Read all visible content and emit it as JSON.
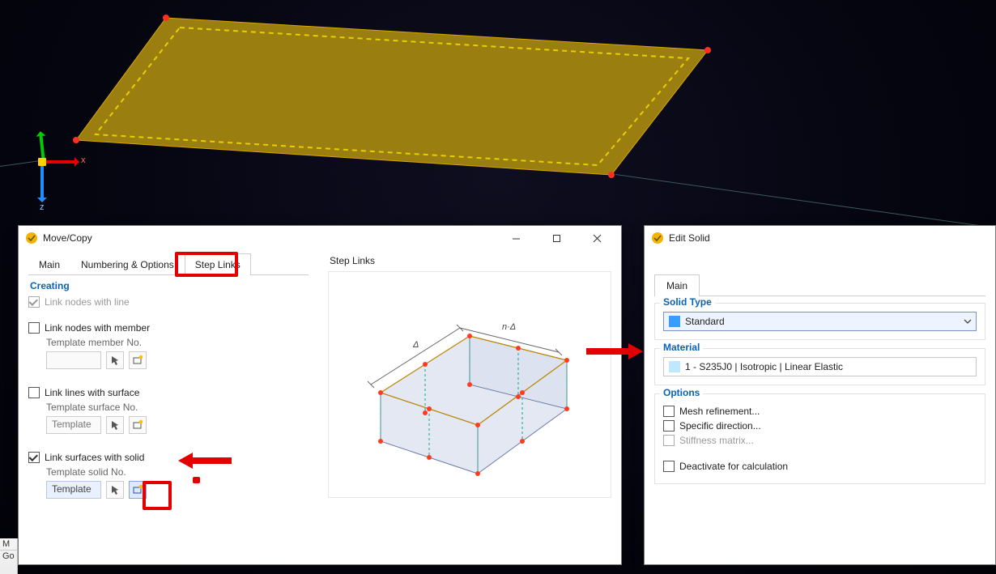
{
  "movecopy": {
    "title": "Move/Copy",
    "tabs": {
      "main": "Main",
      "numbering": "Numbering & Options",
      "steplinks": "Step Links"
    },
    "section_creating": "Creating",
    "link_nodes_line": "Link nodes with line",
    "link_nodes_member": "Link nodes with member",
    "template_member_no": "Template member No.",
    "link_lines_surface": "Link lines with surface",
    "template_surface_no": "Template surface No.",
    "template_surface_value": "Template",
    "link_surfaces_solid": "Link surfaces with solid",
    "template_solid_no": "Template solid No.",
    "template_solid_value": "Template",
    "right_title": "Step Links"
  },
  "editsolid": {
    "title": "Edit Solid",
    "tab_main": "Main",
    "group_solidtype": "Solid Type",
    "solidtype_value": "Standard",
    "group_material": "Material",
    "material_value": "1 - S235J0 | Isotropic | Linear Elastic",
    "group_options": "Options",
    "opt_mesh": "Mesh refinement...",
    "opt_direction": "Specific direction...",
    "opt_stiffness": "Stiffness matrix...",
    "opt_deactivate": "Deactivate for calculation"
  },
  "crop": {
    "line1": "M",
    "line2": "Go"
  },
  "axes": {
    "x": "x",
    "z": "z"
  }
}
